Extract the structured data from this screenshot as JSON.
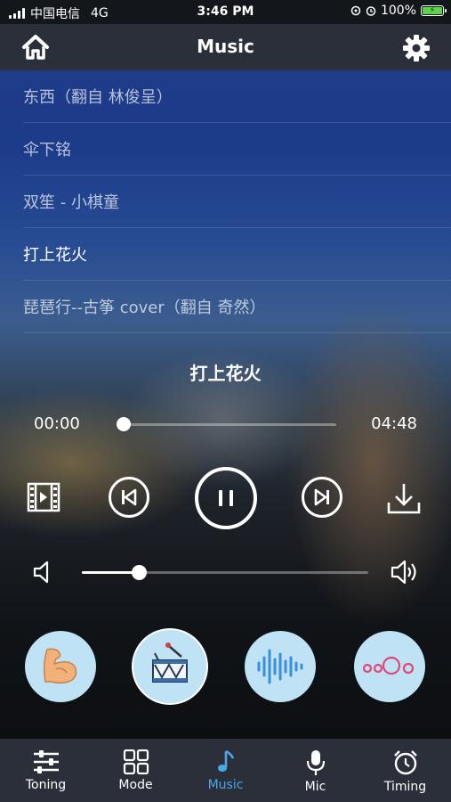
{
  "status_bar": {
    "carrier": "中国电信",
    "network": "4G",
    "time": "3:46 PM",
    "battery": "100%"
  },
  "header": {
    "title": "Music"
  },
  "songs": [
    {
      "title": "东西（翻自 林俊呈）",
      "active": false
    },
    {
      "title": "伞下铭",
      "active": false
    },
    {
      "title": "双笙 - 小棋童",
      "active": false
    },
    {
      "title": "打上花火",
      "active": true
    },
    {
      "title": "琵琶行--古筝 cover（翻自 奇然）",
      "active": false
    }
  ],
  "player": {
    "now_playing": "打上花火",
    "current_time": "00:00",
    "total_time": "04:48",
    "progress": 0.02,
    "volume": 0.2
  },
  "modes": [
    {
      "icon": "flexed-arm-icon"
    },
    {
      "icon": "drum-icon",
      "selected": true
    },
    {
      "icon": "sound-wave-icon"
    },
    {
      "icon": "circles-icon"
    }
  ],
  "tabs": [
    {
      "label": "Toning",
      "icon": "sliders-icon"
    },
    {
      "label": "Mode",
      "icon": "grid-icon"
    },
    {
      "label": "Music",
      "icon": "music-note-icon",
      "active": true
    },
    {
      "label": "Mic",
      "icon": "microphone-icon"
    },
    {
      "label": "Timing",
      "icon": "alarm-clock-icon"
    }
  ],
  "colors": {
    "accent": "#4aa8e8",
    "bar_bg": "#2a2f3a",
    "mode_circle": "#bfe3f5"
  }
}
